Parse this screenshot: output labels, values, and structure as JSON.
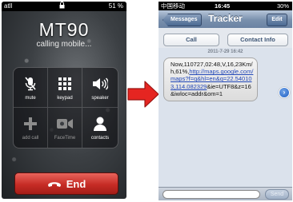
{
  "call_screen": {
    "status_bar": {
      "carrier": "atll",
      "time": "",
      "battery": "51 %"
    },
    "caller_name": "MT90",
    "call_status": "calling mobile...",
    "buttons": [
      {
        "label": "mute",
        "icon": "mic-off-icon",
        "enabled": true
      },
      {
        "label": "keypad",
        "icon": "keypad-icon",
        "enabled": true
      },
      {
        "label": "speaker",
        "icon": "speaker-icon",
        "enabled": true
      },
      {
        "label": "add call",
        "icon": "plus-icon",
        "enabled": false
      },
      {
        "label": "FaceTime",
        "icon": "video-camera-icon",
        "enabled": false
      },
      {
        "label": "contacts",
        "icon": "person-icon",
        "enabled": true
      }
    ],
    "end_label": "End",
    "end_color": "#c62c25"
  },
  "arrow": {
    "color": "#e52521"
  },
  "sms_screen": {
    "status_bar": {
      "carrier": "中国移动",
      "time": "16:45",
      "battery": "30%"
    },
    "nav": {
      "back_label": "Messages",
      "title": "Tracker",
      "edit_label": "Edit"
    },
    "actions": {
      "call_label": "Call",
      "contact_label": "Contact Info"
    },
    "timestamp": "2011-7-29 16:42",
    "message": {
      "prefix": "Now,110727,02:48,V,16,23Km/h,61%,",
      "link": "http://maps.google.com/maps?f=q&hl=en&q=22.540103,114.082329",
      "suffix": "&ie=UTF8&z=16&iwloc=addr&om=1"
    },
    "compose": {
      "placeholder": "",
      "send_label": "Send"
    }
  }
}
